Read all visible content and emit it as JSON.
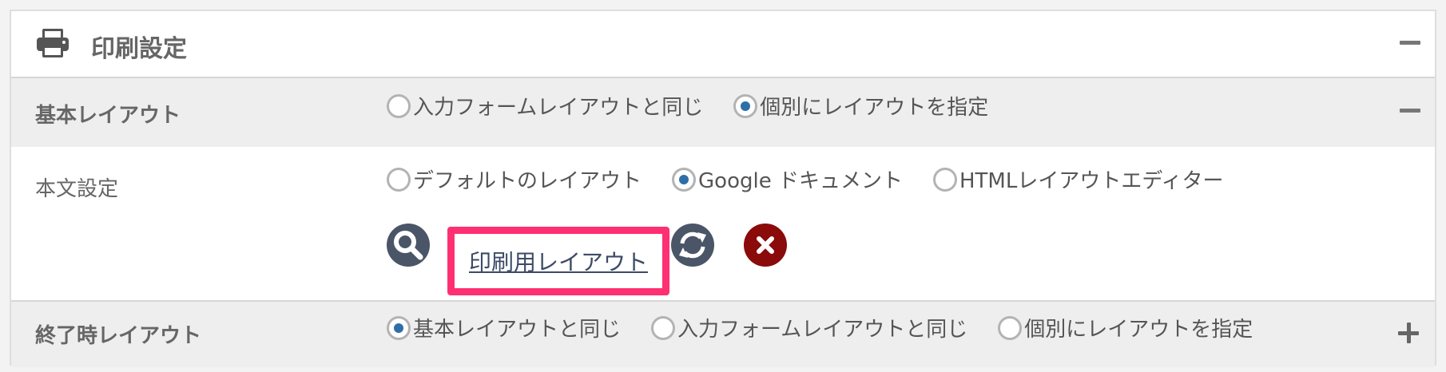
{
  "header": {
    "title": "印刷設定"
  },
  "base_layout": {
    "label": "基本レイアウト",
    "options": [
      {
        "label": "入力フォームレイアウトと同じ",
        "checked": false
      },
      {
        "label": "個別にレイアウトを指定",
        "checked": true
      }
    ]
  },
  "body_settings": {
    "label": "本文設定",
    "options": [
      {
        "label": "デフォルトのレイアウト",
        "checked": false
      },
      {
        "label": "Google ドキュメント",
        "checked": true
      },
      {
        "label": "HTMLレイアウトエディター",
        "checked": false
      }
    ],
    "layout_link": "印刷用レイアウト"
  },
  "end_layout": {
    "label": "終了時レイアウト",
    "options": [
      {
        "label": "基本レイアウトと同じ",
        "checked": true
      },
      {
        "label": "入力フォームレイアウトと同じ",
        "checked": false
      },
      {
        "label": "個別にレイアウトを指定",
        "checked": false
      }
    ]
  },
  "icons": {
    "header": "printer-icon",
    "collapse": "minus-icon",
    "expand": "plus-icon",
    "search": "search-icon",
    "refresh": "refresh-icon",
    "delete": "close-icon"
  },
  "colors": {
    "radio_checked": "#2f6fa8",
    "highlight_border": "#ff2f73",
    "delete_button": "#8b0a0a",
    "icon_button": "#4a5568"
  }
}
